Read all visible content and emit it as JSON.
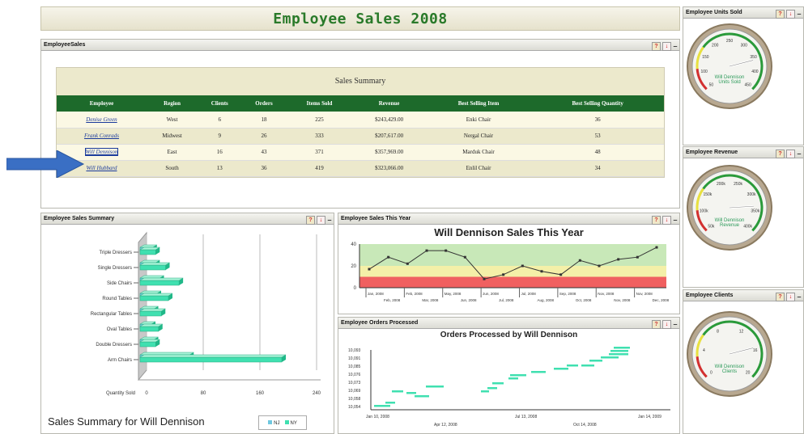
{
  "dashboard": {
    "title": "Employee Sales 2008"
  },
  "employee_sales": {
    "panel_title": "EmployeeSales",
    "table_title": "Sales Summary",
    "columns": [
      "Employee",
      "Region",
      "Clients",
      "Orders",
      "Items Sold",
      "Revenue",
      "Best Selling Item",
      "Best Selling Quantity"
    ],
    "rows": [
      [
        "Denise Green",
        "West",
        "6",
        "18",
        "225",
        "$243,429.00",
        "Enki Chair",
        "36"
      ],
      [
        "Frank Conrads",
        "Midwest",
        "9",
        "26",
        "333",
        "$207,617.00",
        "Nergal Chair",
        "53"
      ],
      [
        "Will Dennison",
        "East",
        "16",
        "43",
        "371",
        "$357,969.00",
        "Marduk Chair",
        "48"
      ],
      [
        "Will Hubbard",
        "South",
        "13",
        "36",
        "419",
        "$323,066.00",
        "Enlil Chair",
        "34"
      ]
    ],
    "selected_row": 2
  },
  "sales_summary": {
    "panel_title": "Employee Sales Summary",
    "footer_title": "Sales Summary for Will Dennison",
    "legend": [
      "NJ",
      "NY"
    ]
  },
  "sales_this_year": {
    "panel_title": "Employee Sales This Year",
    "chart_title": "Will Dennison Sales This Year"
  },
  "orders_processed": {
    "panel_title": "Employee Orders Processed",
    "chart_title": "Orders Processed by Will Dennison"
  },
  "gauges": [
    {
      "panel_title": "Employee Units Sold",
      "label_line1": "Will Dennison",
      "label_line2": "Units Sold",
      "ticks": [
        "50",
        "100",
        "150",
        "200",
        "250",
        "300",
        "350",
        "400",
        "450"
      ],
      "value_fraction": 0.78
    },
    {
      "panel_title": "Employee Revenue",
      "label_line1": "Will Dennison",
      "label_line2": "Revenue",
      "ticks": [
        "50k",
        "100k",
        "150k",
        "200k",
        "250k",
        "300k",
        "350k",
        "400k"
      ],
      "value_fraction": 0.82
    },
    {
      "panel_title": "Employee Clients",
      "label_line1": "Will Dennison",
      "label_line2": "Clients",
      "ticks": [
        "0",
        "4",
        "8",
        "12",
        "16",
        "20"
      ],
      "value_fraction": 0.78
    }
  ],
  "colors": {
    "accent_green": "#1d6a2b",
    "title_green": "#2a7a2a",
    "arrow_blue": "#3a6fc4",
    "bar_teal": "#40e0b0"
  },
  "chart_data": [
    {
      "type": "bar",
      "orientation": "horizontal",
      "categories": [
        "Triple Dressers",
        "Single Dressers",
        "Side Chairs",
        "Round Tables",
        "Rectangular Tables",
        "Oval Tables",
        "Double Dressers",
        "Arm Chairs"
      ],
      "series": [
        {
          "name": "NJ",
          "values": [
            18,
            22,
            28,
            24,
            20,
            16,
            20,
            70
          ]
        },
        {
          "name": "NY",
          "values": [
            22,
            36,
            55,
            40,
            30,
            26,
            22,
            200
          ]
        }
      ],
      "xlabel": "Quantity Sold",
      "xticks": [
        "0",
        "80",
        "160",
        "240"
      ],
      "xlim": [
        0,
        240
      ]
    },
    {
      "type": "line",
      "title": "Will Dennison Sales This Year",
      "x": [
        "Jan, 2008",
        "Feb, 2008",
        "Mar, 2008",
        "Apr, 2008",
        "May, 2008",
        "Jun, 2008",
        "Jul, 2008",
        "Aug, 2008",
        "Sep, 2008",
        "Oct, 2008",
        "Nov, 2008",
        "Dec, 2008"
      ],
      "xticks_top": [
        "Jan, 2008",
        "Feb, 2008",
        "May, 2008",
        "Jun, 2008",
        "Jul, 2008",
        "Sep, 2008",
        "Nov, 2008",
        "Nov, 2008"
      ],
      "xticks_bottom": [
        "Feb, 2008",
        "Mar, 2008",
        "Jun, 2008",
        "Jul, 2008",
        "Aug, 2008",
        "Oct, 2008",
        "Nov, 2008",
        "Dec, 2008"
      ],
      "y": [
        17,
        28,
        22,
        34,
        34,
        28,
        8,
        12,
        20,
        15,
        12,
        25,
        20,
        26,
        28,
        37
      ],
      "yticks": [
        "0",
        "20",
        "40"
      ],
      "ylim": [
        0,
        40
      ],
      "bands": [
        {
          "from": 0,
          "to": 10,
          "color": "#f06060"
        },
        {
          "from": 10,
          "to": 20,
          "color": "#f4f0a8"
        },
        {
          "from": 20,
          "to": 40,
          "color": "#c8e8b8"
        }
      ]
    },
    {
      "type": "scatter",
      "title": "Orders Processed by Will Dennison",
      "yticks": [
        "10,093",
        "10,091",
        "10,085",
        "10,076",
        "10,073",
        "10,069",
        "10,058",
        "10,054"
      ],
      "xticks_top": [
        "Jan 10, 2008",
        "Jul 13, 2008",
        "Jan 14, 2009"
      ],
      "xticks_bottom": [
        "Apr 12, 2008",
        "Oct 14, 2008"
      ]
    }
  ]
}
